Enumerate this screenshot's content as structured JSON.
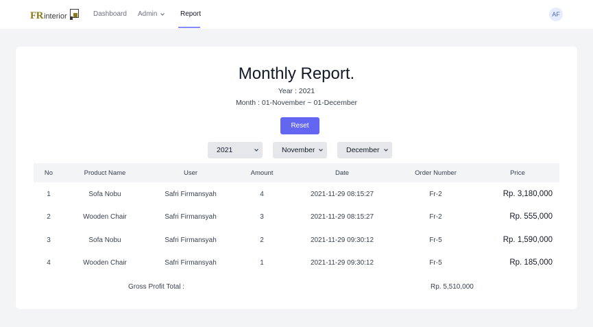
{
  "nav": {
    "logo_fr": "FR",
    "logo_interior": "interior",
    "dashboard": "Dashboard",
    "admin": "Admin",
    "report": "Report",
    "avatar_initials": "AF"
  },
  "report": {
    "title": "Monthly Report.",
    "year_line": "Year : 2021",
    "month_line": "Month : 01-November ~ 01-December",
    "reset_label": "Reset",
    "filters": {
      "year": "2021",
      "from_month": "November",
      "to_month": "December"
    }
  },
  "table": {
    "headers": [
      "No",
      "Product Name",
      "User",
      "Amount",
      "Date",
      "Order Number",
      "Price"
    ],
    "rows": [
      {
        "no": "1",
        "product": "Sofa Nobu",
        "user": "Safri Firmansyah",
        "amount": "4",
        "date": "2021-11-29 08:15:27",
        "order": "Fr-2",
        "price": "Rp. 3,180,000"
      },
      {
        "no": "2",
        "product": "Wooden Chair",
        "user": "Safri Firmansyah",
        "amount": "3",
        "date": "2021-11-29 08:15:27",
        "order": "Fr-2",
        "price": "Rp. 555,000"
      },
      {
        "no": "3",
        "product": "Sofa Nobu",
        "user": "Safri Firmansyah",
        "amount": "2",
        "date": "2021-11-29 09:30:12",
        "order": "Fr-5",
        "price": "Rp. 1,590,000"
      },
      {
        "no": "4",
        "product": "Wooden Chair",
        "user": "Safri Firmansyah",
        "amount": "1",
        "date": "2021-11-29 09:30:12",
        "order": "Fr-5",
        "price": "Rp. 185,000"
      }
    ],
    "gross_label": "Gross Profit Total :",
    "gross_value": "Rp. 5,510,000"
  },
  "colors": {
    "accent": "#6366f1",
    "nav_underline": "#818cf8",
    "logo_gold": "#8a7a1a",
    "page_bg": "#f3f4f6"
  },
  "icons": {
    "admin_dropdown": "chevron-down-icon",
    "select_arrow": "chevron-down-icon"
  }
}
